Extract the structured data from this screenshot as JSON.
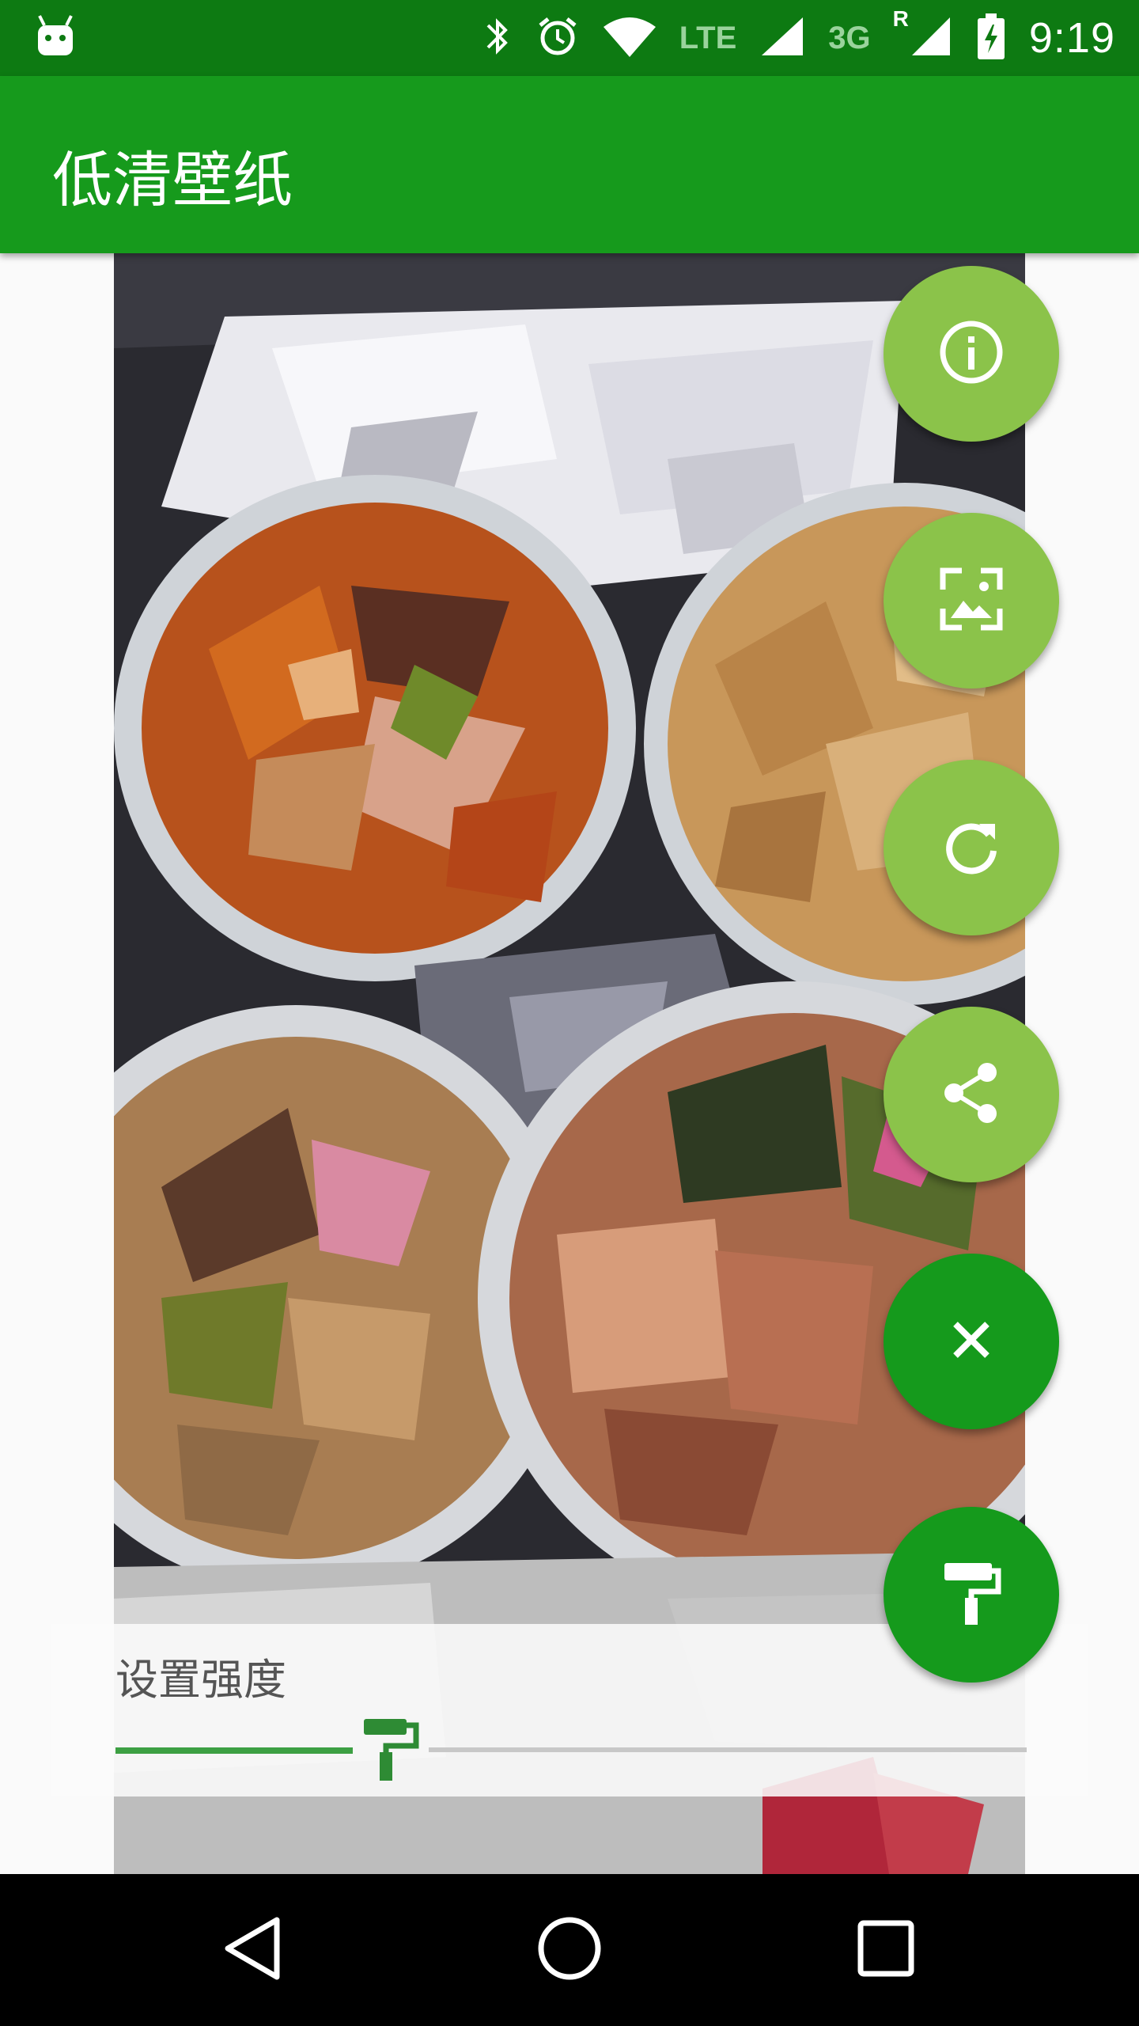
{
  "status_bar": {
    "time": "9:19",
    "network_lte": "LTE",
    "network_3g": "3G",
    "roaming": "R",
    "icons": [
      "android-icon",
      "bluetooth-icon",
      "alarm-icon",
      "wifi-icon",
      "signal-icon",
      "battery-charging-icon"
    ]
  },
  "app_bar": {
    "title": "低清壁纸"
  },
  "fabs": [
    {
      "name": "info",
      "icon": "info-icon",
      "color": "#8bc34a"
    },
    {
      "name": "set-wallpaper",
      "icon": "wallpaper-icon",
      "color": "#8bc34a"
    },
    {
      "name": "refresh",
      "icon": "refresh-icon",
      "color": "#8bc34a"
    },
    {
      "name": "share",
      "icon": "share-icon",
      "color": "#8bc34a"
    },
    {
      "name": "close",
      "icon": "close-icon",
      "color": "#159a1c"
    },
    {
      "name": "paint",
      "icon": "paint-roller-icon",
      "color": "#159a1c"
    }
  ],
  "strength": {
    "label": "设置强度",
    "value_fraction": 0.27
  },
  "nav_bar": {
    "icons": [
      "back-icon",
      "home-icon",
      "recents-icon"
    ]
  },
  "colors": {
    "status_bar": "#0d7a12",
    "app_bar": "#169a1c",
    "accent_light": "#8bc34a",
    "accent_dark": "#159a1c",
    "slider_active": "#3da043"
  }
}
